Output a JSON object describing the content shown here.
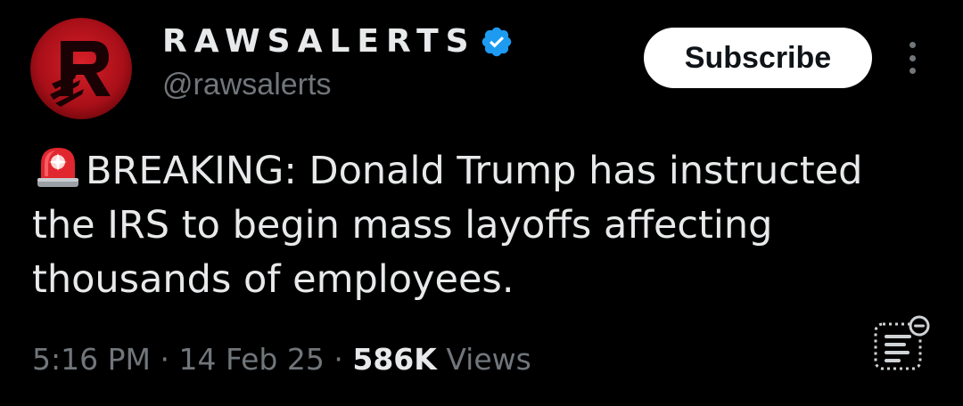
{
  "author": {
    "display_name": "RAWSALERTS",
    "handle": "@rawsalerts",
    "verified": true,
    "avatar_icon": "rawsalerts-logo",
    "avatar_color": "#c0141e"
  },
  "subscribe_label": "Subscribe",
  "more_icon": "vertical-ellipsis-icon",
  "tweet": {
    "emoji": "siren-emoji",
    "text": "BREAKING: Donald Trump has instructed the IRS to begin mass layoffs affecting thousands of employees."
  },
  "meta": {
    "time": "5:16 PM",
    "separator1": "·",
    "date": "14 Feb 25",
    "separator2": "·",
    "views_count": "586K",
    "views_label": "Views"
  },
  "colors": {
    "background": "#000000",
    "text": "#e7e9ea",
    "muted": "#71767b",
    "verified": "#1d9bf0"
  }
}
